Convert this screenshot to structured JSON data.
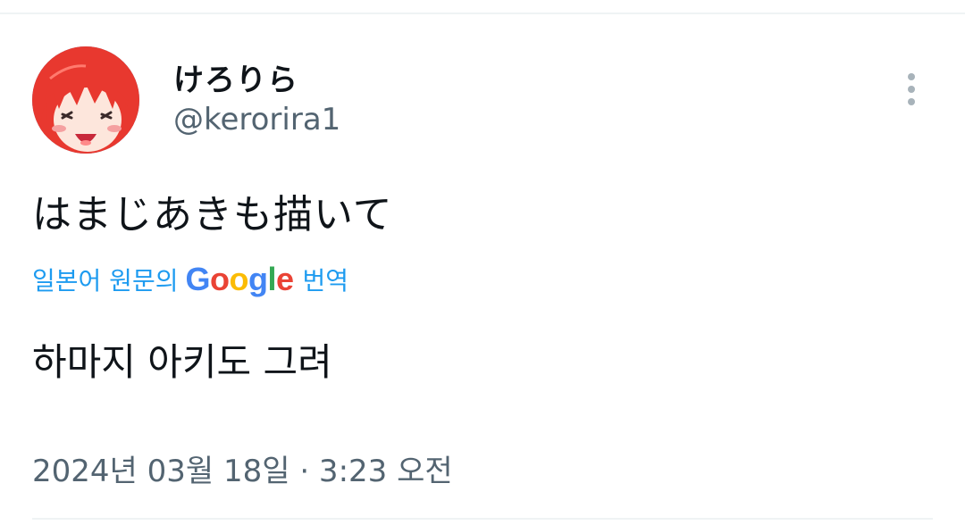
{
  "tweet": {
    "author": {
      "display_name": "けろりら",
      "handle": "@kerorira1"
    },
    "text": "はまじあきも描いて",
    "translation": {
      "source_label": "일본어 원문의",
      "provider": "Google",
      "suffix": "번역",
      "text": "하마지 아키도 그려"
    },
    "timestamp": "2024년 03월 18일 · 3:23 오전"
  },
  "icons": {
    "avatar": "anime-girl-red-hair-avatar",
    "more": "more-vertical-icon"
  },
  "colors": {
    "link_blue": "#1d9bf0",
    "secondary_text": "#536471",
    "avatar_hair": "#e8382f"
  }
}
